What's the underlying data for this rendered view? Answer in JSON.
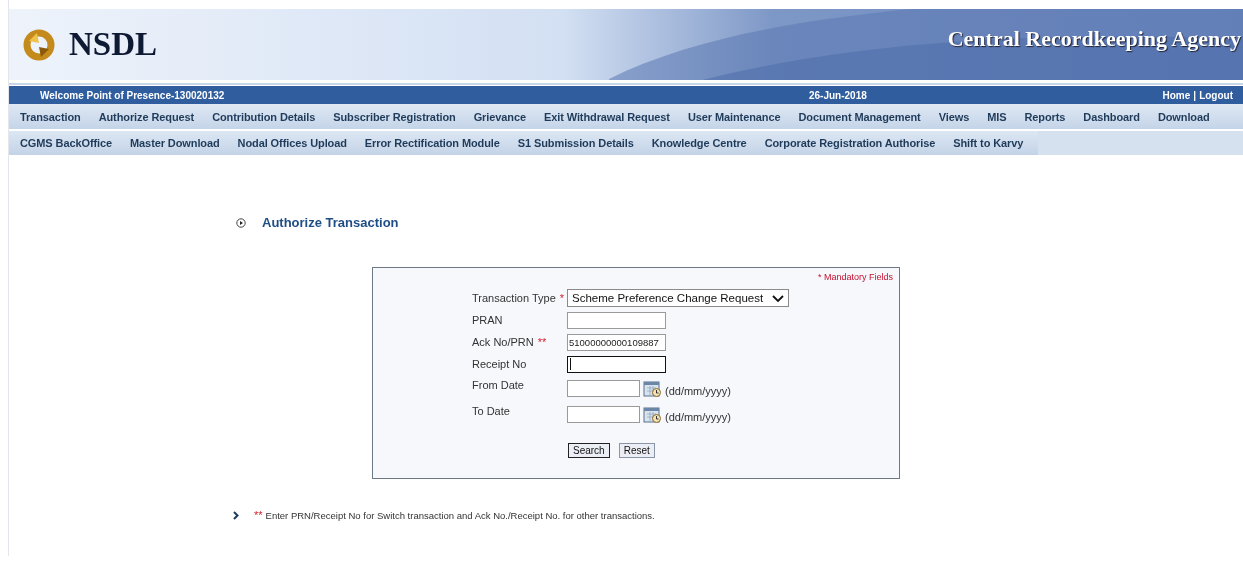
{
  "header": {
    "logo_text": "NSDL",
    "tagline": "Central Recordkeeping Agency"
  },
  "info_bar": {
    "welcome": "Welcome Point of Presence-130020132",
    "date": "26-Jun-2018",
    "links": [
      "Home",
      "Logout"
    ],
    "separator": "|"
  },
  "menu_rows": [
    [
      "Transaction",
      "Authorize Request",
      "Contribution Details",
      "Subscriber Registration",
      "Grievance",
      "Exit Withdrawal Request",
      "User Maintenance",
      "Document Management",
      "Views",
      "MIS",
      "Reports",
      "Dashboard",
      "Download"
    ],
    [
      "CGMS BackOffice",
      "Master Download",
      "Nodal Offices Upload",
      "Error Rectification Module",
      "S1 Submission Details",
      "Knowledge Centre",
      "Corporate Registration Authorise",
      "Shift to Karvy"
    ]
  ],
  "page_heading": "Authorize Transaction",
  "form": {
    "mandatory_note": "* Mandatory Fields",
    "fields": [
      {
        "kind": "select",
        "label": "Transaction Type",
        "marker": "*",
        "value": "Scheme Preference Change Request"
      },
      {
        "kind": "text",
        "label": "PRAN",
        "focused": false
      },
      {
        "kind": "text",
        "label": "Ack No/PRN",
        "marker": "**",
        "value": "51000000000109887",
        "focused": false
      },
      {
        "kind": "text",
        "label": "Receipt No",
        "focused": true
      },
      {
        "kind": "date",
        "label": "From Date",
        "hint": "(dd/mm/yyyy)",
        "focused": false
      },
      {
        "kind": "date",
        "label": "To Date",
        "hint": "(dd/mm/yyyy)",
        "focused": false
      }
    ],
    "buttons": [
      {
        "label": "Search",
        "focused": true
      },
      {
        "label": "Reset",
        "focused": false
      }
    ]
  },
  "note": {
    "marker": "**",
    "text": "Enter PRN/Receipt No for Switch transaction and Ack No./Receipt No. for other transactions."
  }
}
